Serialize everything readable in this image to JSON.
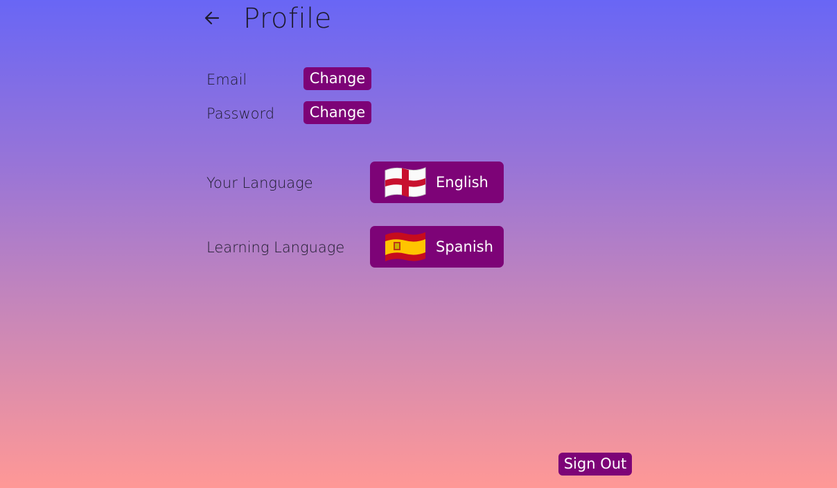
{
  "header": {
    "back_icon": "arrow-left-icon",
    "title": "Profile"
  },
  "account": {
    "email_label": "Email",
    "email_button": "Change",
    "password_label": "Password",
    "password_button": "Change"
  },
  "languages": {
    "your_language_label": "Your Language",
    "your_language_value": "English",
    "your_language_flag": "england-flag-icon",
    "learning_language_label": "Learning Language",
    "learning_language_value": "Spanish",
    "learning_language_flag": "spain-flag-icon"
  },
  "footer": {
    "sign_out_label": "Sign Out"
  },
  "colors": {
    "button_bg": "#7d0377",
    "gradient_top": "#6966f5",
    "gradient_bottom": "#ff9896"
  }
}
